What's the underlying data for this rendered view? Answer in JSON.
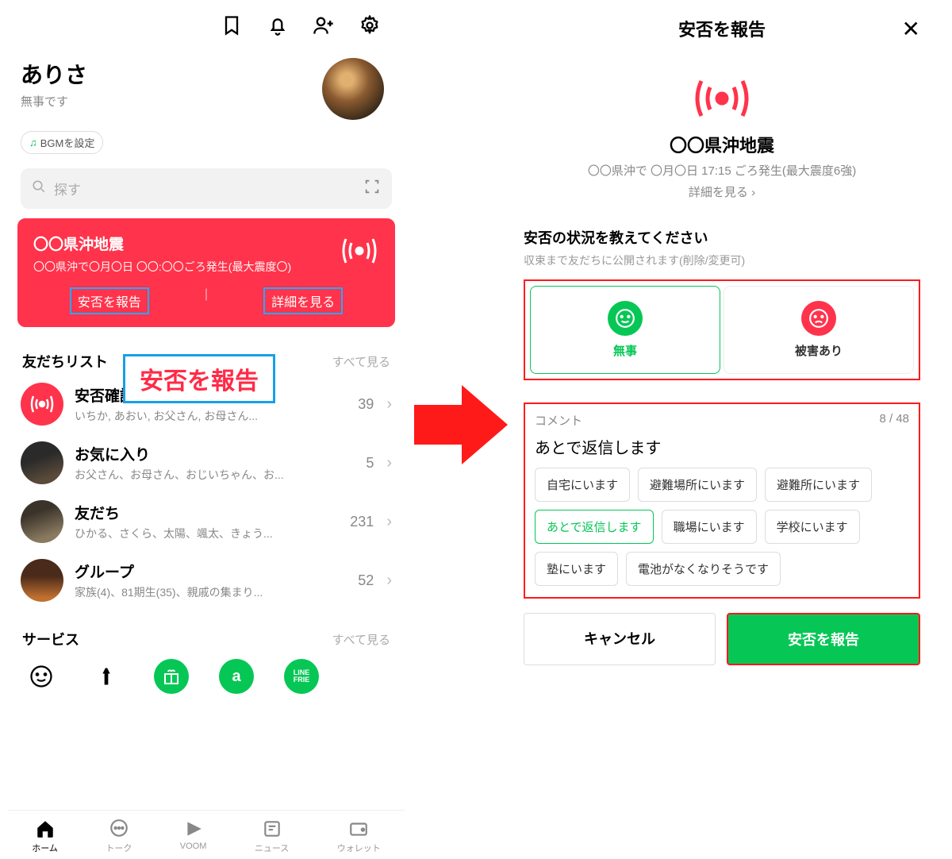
{
  "left": {
    "profile_name": "ありさ",
    "profile_status": "無事です",
    "bgm_label": "BGMを設定",
    "search_placeholder": "探す",
    "alert": {
      "title": "〇〇県沖地震",
      "subtitle": "〇〇県沖で〇月〇日 〇〇:〇〇ごろ発生(最大震度〇)",
      "report_label": "安否を報告",
      "detail_label": "詳細を見る"
    },
    "callout_text": "安否を報告",
    "friends_list_title": "友だちリスト",
    "see_all": "すべて見る",
    "friends": [
      {
        "title": "安否確認",
        "sub": "いちか, あおい, お父さん, お母さん...",
        "count": "39"
      },
      {
        "title": "お気に入り",
        "sub": "お父さん、お母さん、おじいちゃん、お...",
        "count": "5"
      },
      {
        "title": "友だち",
        "sub": "ひかる、さくら、太陽、颯太、きょう...",
        "count": "231"
      },
      {
        "title": "グループ",
        "sub": "家族(4)、81期生(35)、親戚の集まり...",
        "count": "52"
      }
    ],
    "services_title": "サービス",
    "tabs": [
      "ホーム",
      "トーク",
      "VOOM",
      "ニュース",
      "ウォレット"
    ]
  },
  "right": {
    "modal_title": "安否を報告",
    "quake_title": "〇〇県沖地震",
    "quake_sub": "〇〇県沖で 〇月〇日 17:15 ごろ発生(最大震度6強)",
    "quake_detail": "詳細を見る",
    "status_head": "安否の状況を教えてください",
    "status_sub": "収束まで友だちに公開されます(削除/変更可)",
    "opt_safe": "無事",
    "opt_danger": "被害あり",
    "comment_label": "コメント",
    "comment_counter": "8 / 48",
    "comment_text": "あとで返信します",
    "chips": [
      "自宅にいます",
      "避難場所にいます",
      "避難所にいます",
      "あとで返信します",
      "職場にいます",
      "学校にいます",
      "塾にいます",
      "電池がなくなりそうです"
    ],
    "chip_selected_index": 3,
    "cancel": "キャンセル",
    "submit": "安否を報告"
  }
}
